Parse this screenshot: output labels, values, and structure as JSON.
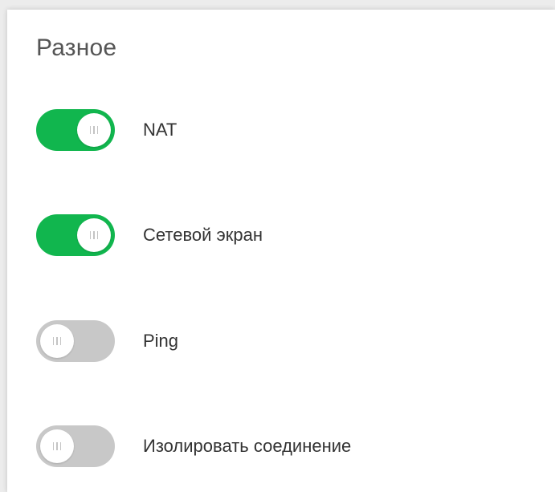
{
  "section": {
    "title": "Разное"
  },
  "toggles": [
    {
      "label": "NAT",
      "state": "on"
    },
    {
      "label": "Сетевой экран",
      "state": "on"
    },
    {
      "label": "Ping",
      "state": "off"
    },
    {
      "label": "Изолировать соединение",
      "state": "off"
    }
  ],
  "colors": {
    "toggle_on": "#11b64e",
    "toggle_off": "#c8c8c8",
    "label_text": "#333333",
    "title_text": "#555555"
  }
}
